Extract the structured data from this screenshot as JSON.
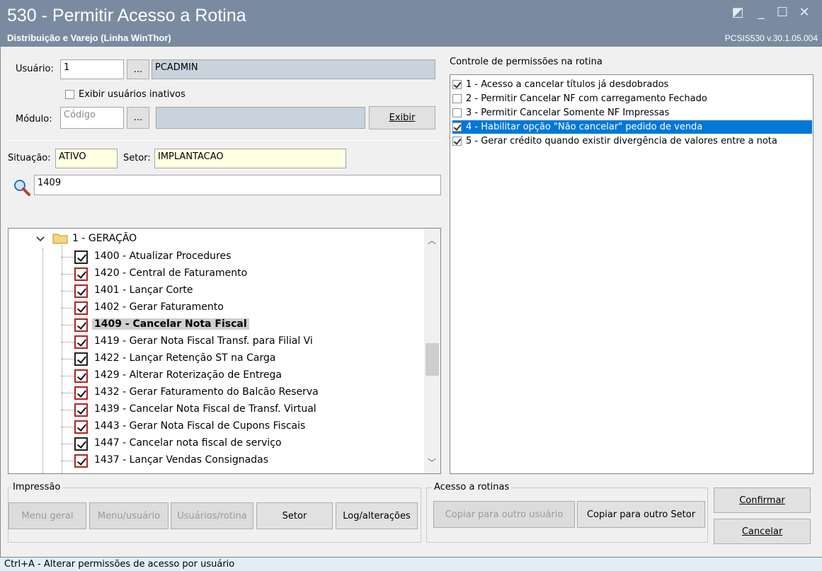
{
  "window": {
    "title": "530 - Permitir Acesso a Rotina",
    "subtitle": "Distribuição e Varejo (Linha WinThor)",
    "version": "PCSIS530  v.30.1.05.004"
  },
  "user": {
    "label": "Usuário:",
    "code": "1",
    "lookup_button": "...",
    "name": "PCADMIN",
    "show_inactive_label": "Exibir usuários inativos"
  },
  "module": {
    "label": "Módulo:",
    "code_placeholder": "Código",
    "lookup_button": "...",
    "name": "",
    "show_button": "Exibir"
  },
  "situation": {
    "label": "Situação:",
    "value": "ATIVO"
  },
  "sector": {
    "label": "Setor:",
    "value": "IMPLANTACAO"
  },
  "search": {
    "value": "1409",
    "icon": "magnifier-icon"
  },
  "permissions": {
    "title": "Controle de permissões na rotina",
    "items": [
      {
        "label": "1 - Acesso a cancelar títulos já desdobrados",
        "checked": true
      },
      {
        "label": "2 - Permitir Cancelar NF com carregamento Fechado",
        "checked": false
      },
      {
        "label": "3 - Permitir Cancelar Somente NF Impressas",
        "checked": false
      },
      {
        "label": "4 - Habilitar opção \"Não cancelar\" pedido de venda",
        "checked": true,
        "selected": true
      },
      {
        "label": "5 - Gerar crédito quando existir divergência de valores entre a nota",
        "checked": true
      }
    ]
  },
  "tree": {
    "folder": "1 - GERAÇÃO",
    "items": [
      {
        "label": "1400 - Atualizar Procedures",
        "checked": true
      },
      {
        "label": "1420 - Central de Faturamento",
        "checked": true
      },
      {
        "label": "1401 - Lançar Corte",
        "checked": true
      },
      {
        "label": "1402 - Gerar Faturamento",
        "checked": true
      },
      {
        "label": "1409 - Cancelar Nota Fiscal",
        "checked": true,
        "highlighted": true
      },
      {
        "label": "1419 - Gerar Nota Fiscal Transf. para Filial Vi",
        "checked": true
      },
      {
        "label": "1422 - Lançar Retenção ST na Carga",
        "checked": true
      },
      {
        "label": "1429 - Alterar Roterização de Entrega",
        "checked": true
      },
      {
        "label": "1432 - Gerar Faturamento do Balcão Reserva",
        "checked": true
      },
      {
        "label": "1439 - Cancelar Nota Fiscal de Transf. Virtual",
        "checked": true
      },
      {
        "label": "1443 - Gerar Nota Fiscal de Cupons Fiscais",
        "checked": true
      },
      {
        "label": "1447 - Cancelar nota fiscal de serviço",
        "checked": true
      },
      {
        "label": "1437 - Lançar Vendas Consignadas",
        "checked": true
      }
    ]
  },
  "print_group": {
    "title": "Impressão",
    "menu_geral": "Menu geral",
    "menu_usuario": "Menu/usuário",
    "usuarios_rotina": "Usuários/rotina",
    "setor": "Setor",
    "log": "Log/alterações"
  },
  "access_group": {
    "title": "Acesso a rotinas",
    "copy_user": "Copiar para outro usuário",
    "copy_sector": "Copiar para outro Setor"
  },
  "actions": {
    "confirm": "Confirmar",
    "cancel": "Cancelar"
  },
  "status_bar": "Ctrl+A - Alterar permissões de acesso por usuário"
}
